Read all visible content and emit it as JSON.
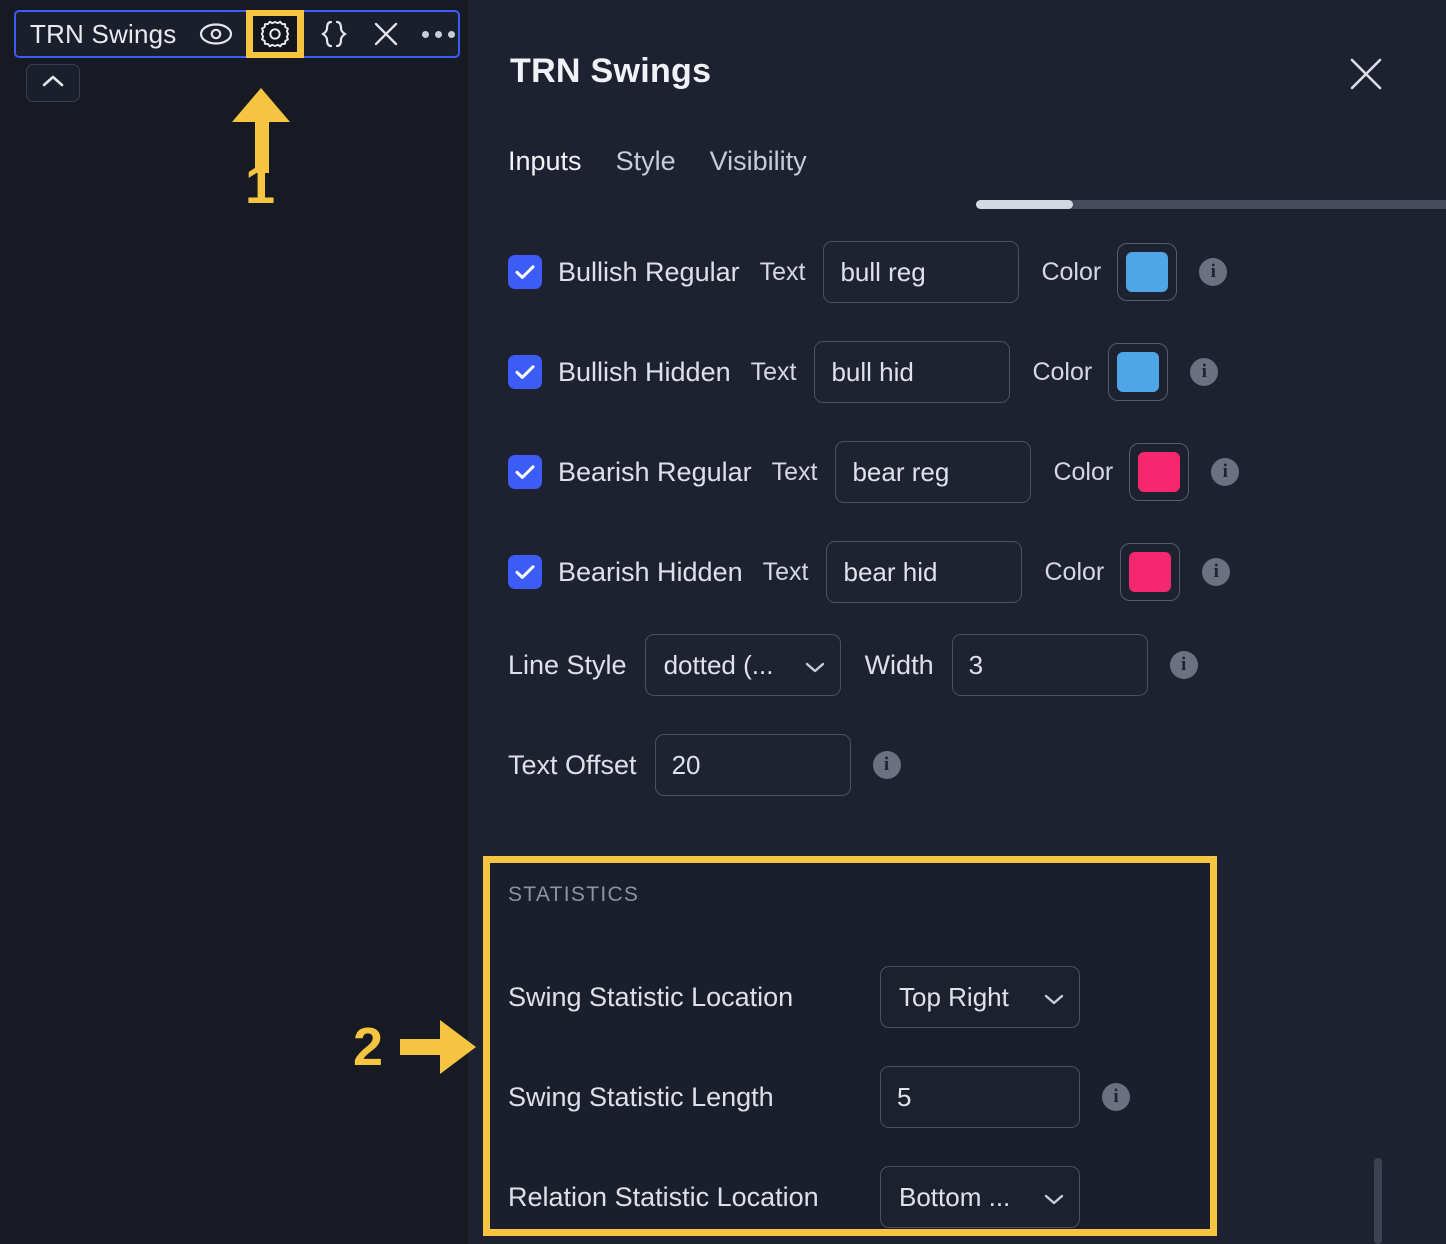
{
  "left_pane": {
    "legend": {
      "title": "TRN Swings",
      "icons": [
        {
          "name": "eye-icon",
          "label": "Toggle visibility"
        },
        {
          "name": "gear-icon",
          "label": "Settings"
        },
        {
          "name": "source-code-icon",
          "label": "Source code"
        },
        {
          "name": "close-icon",
          "label": "Remove"
        },
        {
          "name": "more-options-icon",
          "label": "More"
        }
      ]
    },
    "collapse_button": {
      "name": "chevron-up-icon",
      "label": "Collapse"
    }
  },
  "annotations": [
    {
      "number": "1",
      "points_to": "gear-icon",
      "direction": "up",
      "color": "#F5C542"
    },
    {
      "number": "2",
      "points_to": "statistics-section",
      "direction": "right",
      "color": "#F5C542"
    }
  ],
  "dialog": {
    "title": "TRN Swings",
    "close_label": "Close",
    "tabs": [
      {
        "label": "Inputs",
        "active": true
      },
      {
        "label": "Style",
        "active": false
      },
      {
        "label": "Visibility",
        "active": false
      }
    ],
    "toggle_rows": [
      {
        "checked": true,
        "label": "Bullish Regular",
        "text_label": "Text",
        "text_value": "bull reg",
        "color_label": "Color",
        "color": "#4FA5E6",
        "info": "i"
      },
      {
        "checked": true,
        "label": "Bullish Hidden",
        "text_label": "Text",
        "text_value": "bull hid",
        "color_label": "Color",
        "color": "#4FA5E6",
        "info": "i"
      },
      {
        "checked": true,
        "label": "Bearish Regular",
        "text_label": "Text",
        "text_value": "bear reg",
        "color_label": "Color",
        "color": "#F5276E",
        "info": "i"
      },
      {
        "checked": true,
        "label": "Bearish Hidden",
        "text_label": "Text",
        "text_value": "bear hid",
        "color_label": "Color",
        "color": "#F5276E",
        "info": "i"
      }
    ],
    "line_style": {
      "label": "Line Style",
      "value": "dotted (..."
    },
    "width": {
      "label": "Width",
      "value": "3",
      "info": "i"
    },
    "text_offset": {
      "label": "Text Offset",
      "value": "20",
      "info": "i"
    },
    "statistics": {
      "header": "STATISTICS",
      "swing_statistic_location": {
        "label": "Swing Statistic Location",
        "value": "Top Right"
      },
      "swing_statistic_length": {
        "label": "Swing Statistic Length",
        "value": "5",
        "info": "i"
      },
      "relation_statistic_location": {
        "label": "Relation Statistic Location",
        "value": "Bottom ..."
      }
    }
  },
  "colors": {
    "accent_yellow": "#F5C542",
    "checkbox_blue": "#3B5CF6",
    "border_blue": "#3B5CF6",
    "bullish": "#4FA5E6",
    "bearish": "#F5276E",
    "panel_bg": "#1E2230",
    "app_bg": "#171A23"
  }
}
